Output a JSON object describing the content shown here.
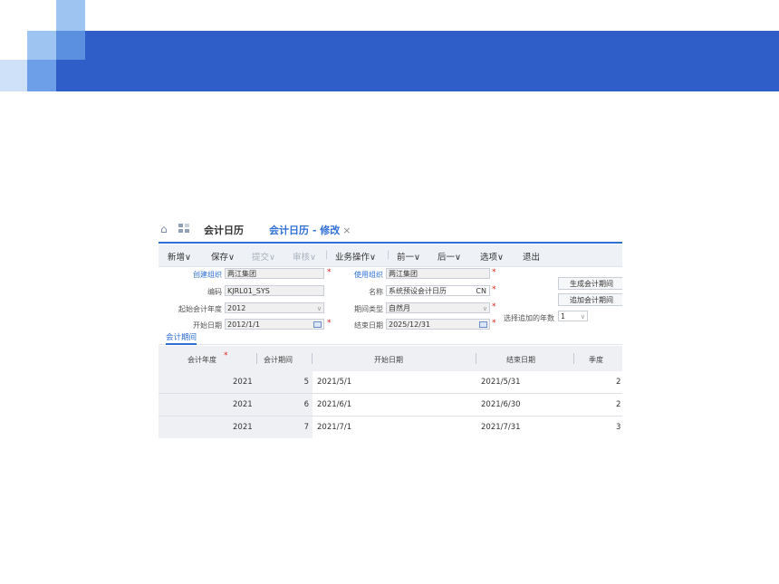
{
  "tabs": {
    "home_icon": "home-icon",
    "tab1_label": "会计日历",
    "tab2_label": "会计日历 - 修改",
    "close_glyph": "×"
  },
  "toolbar": {
    "items": [
      "新增∨",
      "保存∨",
      "提交∨",
      "审核∨",
      "|",
      "业务操作∨",
      "|",
      "前一∨",
      "后一∨",
      "选项∨",
      "退出"
    ]
  },
  "form": {
    "create_org_label": "创建组织",
    "create_org_value": "两江集团",
    "use_org_label": "使用组织",
    "use_org_value": "两江集团",
    "code_label": "编码",
    "code_value": "KJRL01_SYS",
    "name_label": "名称",
    "name_value": "系统预设会计日历",
    "name_lang": "CN",
    "start_year_label": "起始会计年度",
    "start_year_value": "2012",
    "period_type_label": "期间类型",
    "period_type_value": "自然月",
    "start_date_label": "开始日期",
    "start_date_value": "2012/1/1",
    "end_date_label": "结束日期",
    "end_date_value": "2025/12/31",
    "append_years_label": "选择追加的年数",
    "append_years_value": "1",
    "required_mark": "*"
  },
  "side_buttons": {
    "generate_label": "生成会计期间",
    "append_label": "追加会计期间"
  },
  "subtab": {
    "label": "会计期间"
  },
  "table": {
    "headers": [
      "会计年度",
      "会计期间",
      "开始日期",
      "结束日期",
      "季度"
    ],
    "rows": [
      [
        "2021",
        "5",
        "2021/5/1",
        "2021/5/31",
        "2"
      ],
      [
        "2021",
        "6",
        "2021/6/1",
        "2021/6/30",
        "2"
      ],
      [
        "2021",
        "7",
        "2021/7/1",
        "2021/7/31",
        "3"
      ]
    ]
  },
  "colors": {
    "banner": "#2f5ec8",
    "accent": "#2f6fd6",
    "required": "#e02020"
  }
}
